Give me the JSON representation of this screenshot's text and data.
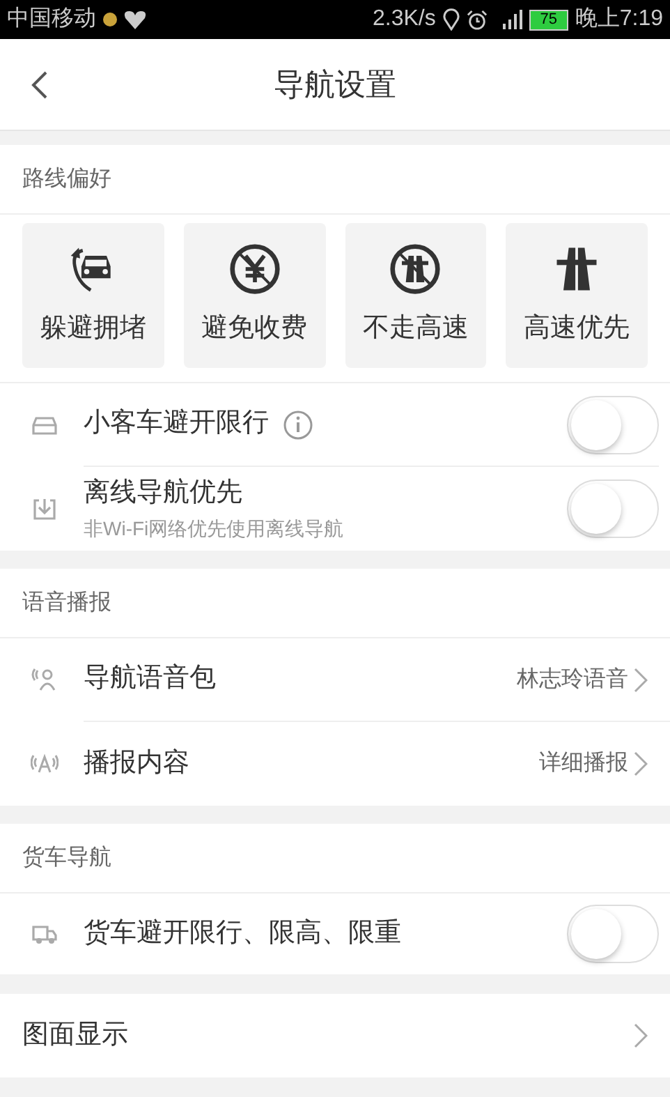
{
  "status_bar": {
    "carrier": "中国移动",
    "speed": "2.3K/s",
    "battery": "75",
    "time": "晚上7:19"
  },
  "header": {
    "title": "导航设置"
  },
  "route_preferences": {
    "title": "路线偏好",
    "options": [
      {
        "label": "躲避拥堵",
        "kind": "avoid-traffic",
        "selected": false
      },
      {
        "label": "避免收费",
        "kind": "no-toll",
        "selected": false
      },
      {
        "label": "不走高速",
        "kind": "no-highway",
        "selected": false
      },
      {
        "label": "高速优先",
        "kind": "highway",
        "selected": false
      }
    ],
    "rows": [
      {
        "label": "小客车避开限行",
        "kind": "car",
        "info": true,
        "on": false
      },
      {
        "label": "离线导航优先",
        "kind": "offline",
        "subtitle": "非Wi-Fi网络优先使用离线导航",
        "on": false
      }
    ]
  },
  "voice": {
    "title": "语音播报",
    "rows": [
      {
        "label": "导航语音包",
        "kind": "voice",
        "value": "林志玲语音"
      },
      {
        "label": "播报内容",
        "kind": "broadcast",
        "value": "详细播报"
      }
    ]
  },
  "truck": {
    "title": "货车导航",
    "rows": [
      {
        "label": "货车避开限行、限高、限重",
        "kind": "truck",
        "on": false
      }
    ]
  },
  "display": {
    "label": "图面显示"
  }
}
